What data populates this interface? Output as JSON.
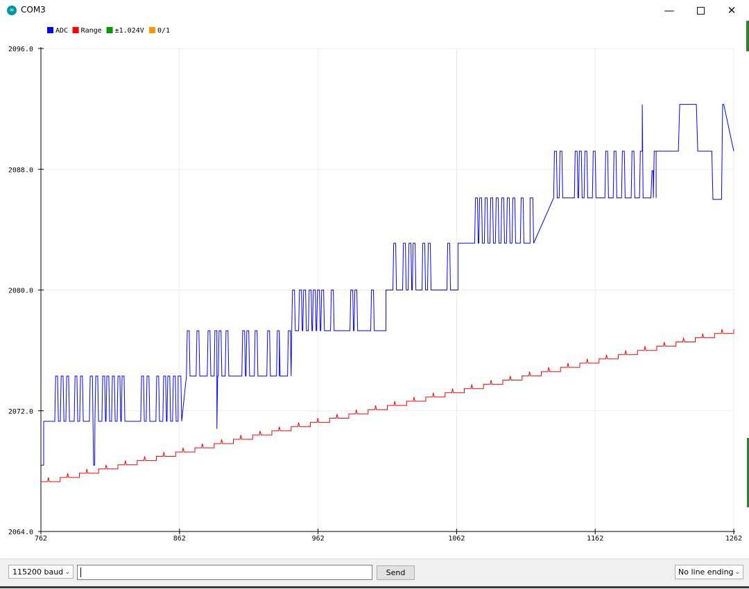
{
  "window": {
    "title": "COM3",
    "icon": "arduino-icon",
    "minimize_glyph": "—",
    "close_glyph": "✕"
  },
  "chart_data": {
    "type": "line",
    "legend_placement": "top-left",
    "grid": true,
    "xlim": [
      762,
      1262
    ],
    "ylim": [
      2064.0,
      2096.0
    ],
    "x_ticks": [
      "762",
      "862",
      "962",
      "1062",
      "1162",
      "1262"
    ],
    "y_ticks": [
      "2064.0",
      "2072.0",
      "2080.0",
      "2088.0",
      "2096.0"
    ],
    "legend": [
      {
        "name": "ADC",
        "color": "#0000ff"
      },
      {
        "name": "Range",
        "color": "#ff0000"
      },
      {
        "name": "±1.024V",
        "color": "#009900"
      },
      {
        "name": "0/1",
        "color": "#ff9900"
      }
    ],
    "series": [
      {
        "name": "ADC",
        "color": "#0000ff",
        "levels": [
          {
            "x_start": 762,
            "base": 2068.4,
            "alt": 2068.4,
            "spikes": []
          },
          {
            "x_start": 764,
            "base": 2071.3,
            "alt": 2074.3,
            "spikes": [
              772,
              776,
              780,
              786,
              790,
              797,
              801,
              806,
              809,
              813,
              817,
              820,
              834,
              838,
              840,
              845,
              850,
              853,
              857,
              861
            ]
          },
          {
            "x_start": 861,
            "base": 2074.3,
            "alt": 2077.3,
            "spikes": [
              867,
              874,
              882,
              887,
              890,
              895,
              907,
              910,
              916,
              925,
              927,
              932,
              934,
              940
            ]
          },
          {
            "x_start": 934,
            "base": 2077.3,
            "alt": 2080.0,
            "spikes": [
              943,
              945,
              948,
              951,
              955,
              958,
              961,
              964,
              966,
              971,
              985,
              988,
              1000
            ]
          },
          {
            "x_start": 1011,
            "base": 2080.0,
            "alt": 2083.1,
            "spikes": [
              1016,
              1023,
              1027,
              1030,
              1037,
              1041,
              1055
            ]
          },
          {
            "x_start": 1063,
            "base": 2083.1,
            "alt": 2086.1,
            "spikes": [
              1075,
              1078,
              1082,
              1086,
              1088,
              1090,
              1094,
              1098,
              1102,
              1108,
              1115
            ]
          },
          {
            "x_start": 1115,
            "base": 2086.1,
            "alt": 2089.2,
            "spikes": [
              1132,
              1134,
              1136,
              1138,
              1147,
              1150,
              1154,
              1160,
              1169,
              1175,
              1181,
              1188,
              1190,
              1194,
              1204,
              1206
            ]
          },
          {
            "x_start": 1206,
            "base": 2089.2,
            "alt": 2092.3,
            "spikes": []
          },
          {
            "x_start": 1240,
            "base": 2089.2,
            "alt": 2089.2,
            "spikes": []
          },
          {
            "x_start": 1262,
            "base": 2089.2,
            "alt": 2089.2,
            "spikes": []
          }
        ],
        "dips": [
          {
            "x": 800,
            "y": 2068.4
          },
          {
            "x": 889,
            "y": 2070.8
          },
          {
            "x": 1203,
            "y": 2087.9
          },
          {
            "x": 1247,
            "y": 2086.0
          }
        ],
        "peaks": [
          {
            "x": 1196,
            "y": 2092.3
          },
          {
            "x": 1254,
            "y": 2092.3
          }
        ]
      },
      {
        "name": "Range",
        "color": "#ff0000",
        "y_start": 2067.3,
        "y_end": 2077.4,
        "x_start": 762,
        "x_end": 1262
      }
    ]
  },
  "footer": {
    "baud": "115200 baud",
    "send_label": "Send",
    "line_ending": "No line ending"
  }
}
